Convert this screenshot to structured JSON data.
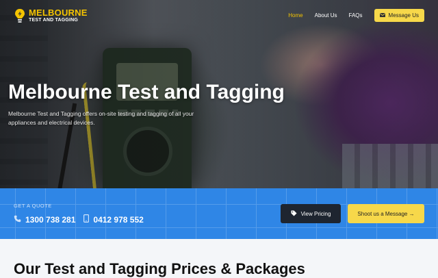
{
  "brand": {
    "name": "MELBOURNE",
    "tagline": "TEST AND TAGGING",
    "accent_color": "#f5c400",
    "icon": "lightbulb-icon"
  },
  "nav": {
    "links": [
      {
        "label": "Home",
        "active": true
      },
      {
        "label": "About Us",
        "active": false
      },
      {
        "label": "FAQs",
        "active": false
      }
    ],
    "cta": {
      "label": "Message Us",
      "icon": "envelope-icon"
    }
  },
  "hero": {
    "title": "Melbourne Test and Tagging",
    "description": "Melbourne Test and Tagging offers on-site testing and tagging of all your appliances and electrical devices."
  },
  "quote_bar": {
    "label": "GET A QUOTE",
    "phones": [
      {
        "number": "1300 738 281",
        "icon": "phone-icon"
      },
      {
        "number": "0412 978 552",
        "icon": "mobile-icon"
      }
    ],
    "buttons": {
      "pricing": {
        "label": "View Pricing",
        "icon": "tag-icon"
      },
      "message": {
        "label": "Shoot us a Message →"
      }
    },
    "bg_color": "#2f86e6"
  },
  "section": {
    "title": "Our Test and Tagging Prices & Packages"
  }
}
